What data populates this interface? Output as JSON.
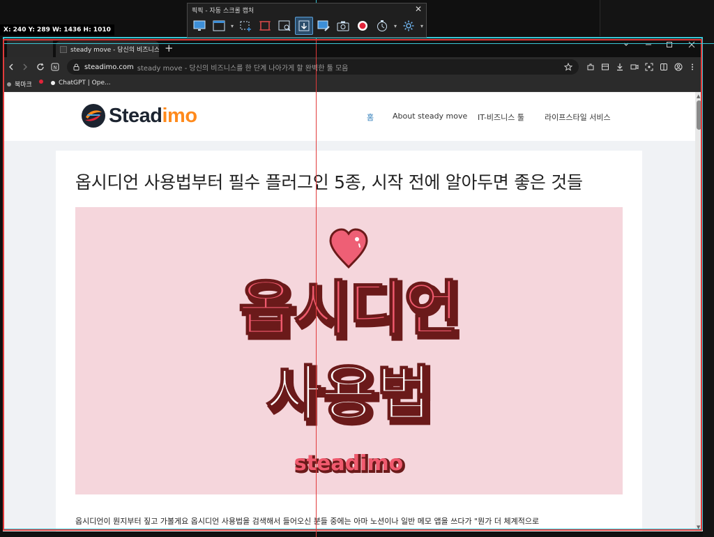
{
  "capture": {
    "title": "픽픽 - 자동 스크롤 캡처",
    "coords": "X: 240 Y: 289 W: 1436 H: 1010",
    "tools": [
      "monitor-icon",
      "window-icon",
      "region-icon",
      "fixed-region-icon",
      "window-select-icon",
      "scroll-capture-icon",
      "draw-icon",
      "camera-icon",
      "record-icon",
      "timer-icon",
      "gear-icon"
    ]
  },
  "browser": {
    "tab_title": "steady move - 당신의 비즈니스를",
    "new_tab": "+",
    "url_host": "steadimo.com",
    "url_rest": "steady move - 당신의 비즈니스를 한 단계 나아가게 할 완벽한 툴 모음",
    "bookmarks": [
      "북마크",
      "ChatGPT | Ope..."
    ]
  },
  "site": {
    "logo_part1": "Stead",
    "logo_part2": "imo",
    "menu": [
      "홈",
      "About steady move",
      "IT-비즈니스 툴",
      "라이프스타일 서비스"
    ]
  },
  "post": {
    "title": "옵시디언 사용법부터 필수 플러그인 5종, 시작 전에 알아두면 좋은 것들",
    "hero_line1": "옵시디언",
    "hero_line2": "사용법",
    "hero_brand": "steadimo",
    "body_first": "옵시디언이 뭔지부터 짚고 가볼게요 옵시디언 사용법을 검색해서 들어오신 분들 중에는 아마 노션이나 일반 메모 앱을 쓰다가 \"뭔가 더 체계적으로"
  },
  "colors": {
    "hero_bg": "#f5d6dc",
    "hero_text": "#f05a6e",
    "accent_orange": "#ff8a1c",
    "menu_active": "#2a7ab8"
  }
}
